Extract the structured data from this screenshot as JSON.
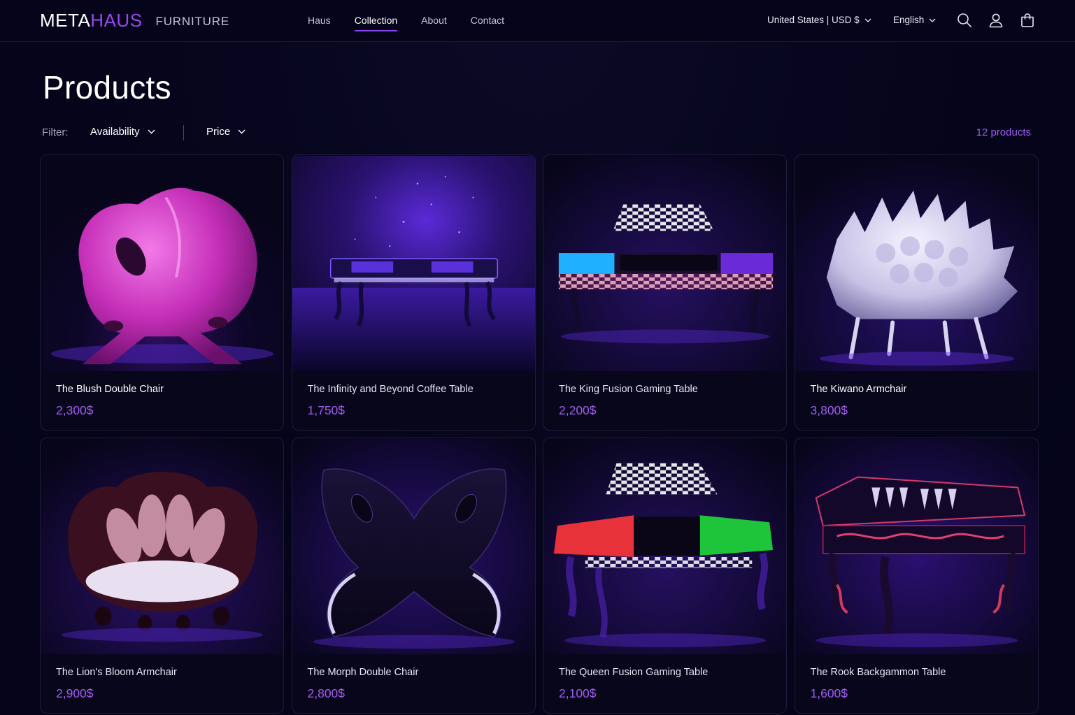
{
  "brand": {
    "name_a": "META",
    "name_b": "HAUS",
    "subtitle": "FURNITURE",
    "accent": "#9a47f0"
  },
  "nav": {
    "items": [
      {
        "label": "Haus",
        "active": false
      },
      {
        "label": "Collection",
        "active": true
      },
      {
        "label": "About",
        "active": false
      },
      {
        "label": "Contact",
        "active": false
      }
    ]
  },
  "header": {
    "currency": "United States | USD $",
    "language": "English",
    "icons": [
      "search-icon",
      "account-icon",
      "cart-icon"
    ]
  },
  "page": {
    "title": "Products"
  },
  "filter": {
    "label": "Filter:",
    "availability": "Availability",
    "price": "Price",
    "count": "12 products"
  },
  "products": [
    {
      "name": "The Blush Double Chair",
      "price": "2,300$",
      "image": "pink-chair"
    },
    {
      "name": "The Infinity and Beyond Coffee Table",
      "price": "1,750$",
      "image": "infinity-table"
    },
    {
      "name": "The King Fusion Gaming Table",
      "price": "2,200$",
      "image": "king-table"
    },
    {
      "name": "The Kiwano Armchair",
      "price": "3,800$",
      "image": "kiwano-chair"
    },
    {
      "name": "The Lion's Bloom Armchair",
      "price": "2,900$",
      "image": "bloom-chair"
    },
    {
      "name": "The Morph Double Chair",
      "price": "2,800$",
      "image": "morph-chair"
    },
    {
      "name": "The Queen Fusion Gaming Table",
      "price": "2,100$",
      "image": "queen-table"
    },
    {
      "name": "The Rook Backgammon Table",
      "price": "1,600$",
      "image": "rook-table"
    }
  ]
}
